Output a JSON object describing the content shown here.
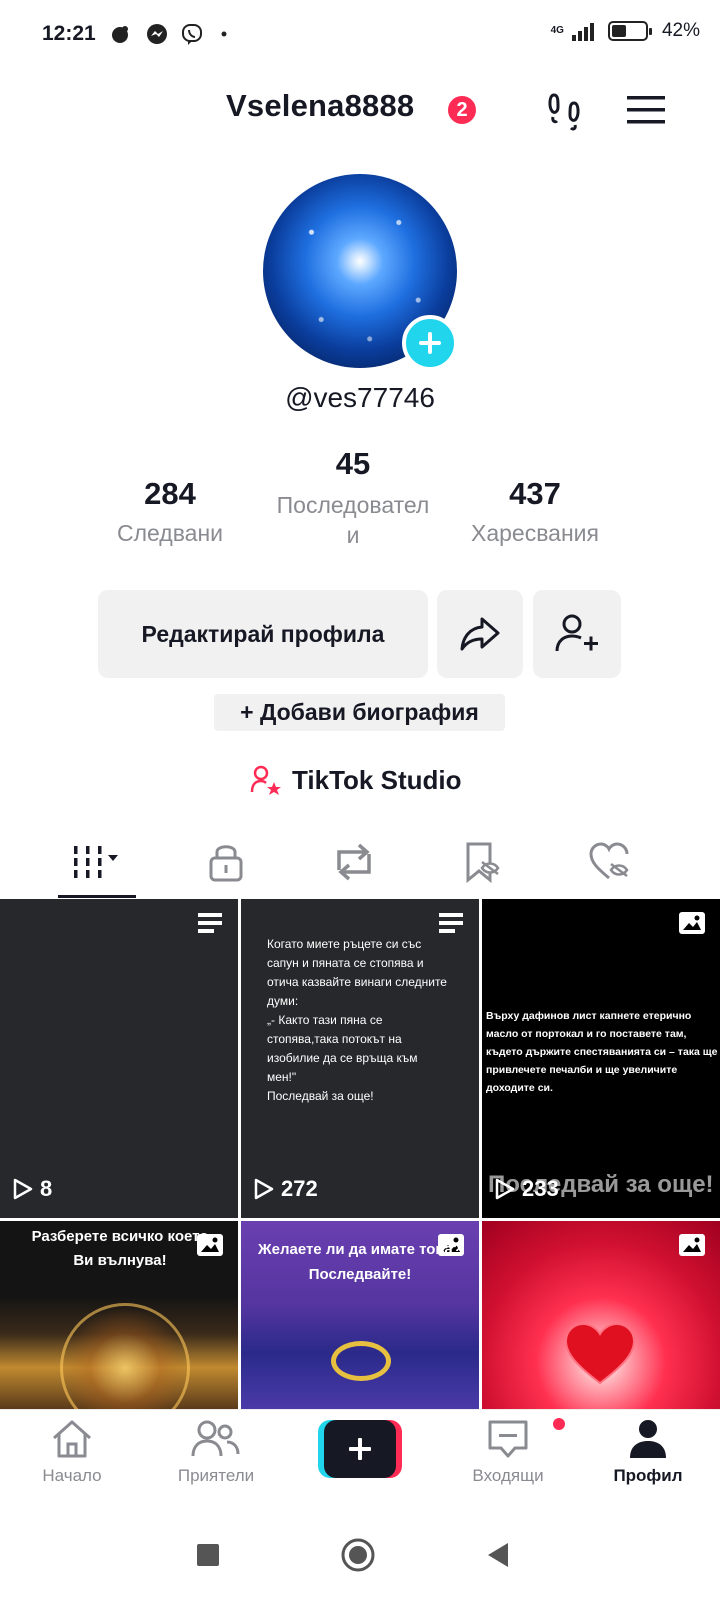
{
  "status_bar": {
    "time": "12:21",
    "network": "4G",
    "battery_pct": "42%",
    "battery_level": 0.42,
    "icons": [
      "notification-icon",
      "messenger-icon",
      "viber-icon",
      "dot-icon",
      "signal-icon",
      "battery-icon"
    ]
  },
  "header": {
    "username": "Vselena8888",
    "notification_count": "2",
    "icons": [
      "footprints-icon",
      "menu-icon"
    ]
  },
  "profile": {
    "handle": "@ves77746",
    "stats": [
      {
        "value": "284",
        "label": "Следвани"
      },
      {
        "value": "45",
        "label_line1": "Последовател",
        "label_line2": "и"
      },
      {
        "value": "437",
        "label": "Харесвания"
      }
    ],
    "edit_label": "Редактирай профила",
    "bio_label": "+ Добави биография",
    "studio_label": "TikTok Studio"
  },
  "tabs": [
    "videos-grid-icon",
    "lock-icon",
    "repost-icon",
    "saved-icon",
    "liked-icon"
  ],
  "grid": {
    "tiles": [
      {
        "views": "8",
        "type": "text-post"
      },
      {
        "views": "272",
        "type": "text-post",
        "text": "Когато миете ръцете си със сапун и пяната се стопява и отича казвайте винаги следните думи:\n„- Както тази пяна се стопява,така потокът на изобилие да се връща към мен!\"\nПоследвай за още!"
      },
      {
        "views": "233",
        "type": "photo",
        "text": "Върху дафинов лист капнете етерично масло от портокал и го поставете там, където държите спестяванията си – така ще привлечете печалби и ще увеличите доходите си.",
        "overlay": "Последвай за още!"
      },
      {
        "type": "photo",
        "text": "Разберете всичко което Ви вълнува!"
      },
      {
        "type": "photo",
        "text": "Желаете ли да имате това?\nПоследвайте!"
      },
      {
        "type": "photo"
      }
    ]
  },
  "bottom_nav": {
    "items": [
      {
        "label": "Начало",
        "icon": "home-icon"
      },
      {
        "label": "Приятели",
        "icon": "friends-icon"
      },
      {
        "label": "",
        "icon": "plus-icon"
      },
      {
        "label": "Входящи",
        "icon": "inbox-icon"
      },
      {
        "label": "Профил",
        "icon": "profile-icon"
      }
    ]
  },
  "colors": {
    "accent_red": "#fe2c55",
    "accent_cyan": "#20d5ec",
    "text_primary": "#161823",
    "text_secondary": "#8a8b91",
    "button_bg": "#f1f1f2"
  }
}
